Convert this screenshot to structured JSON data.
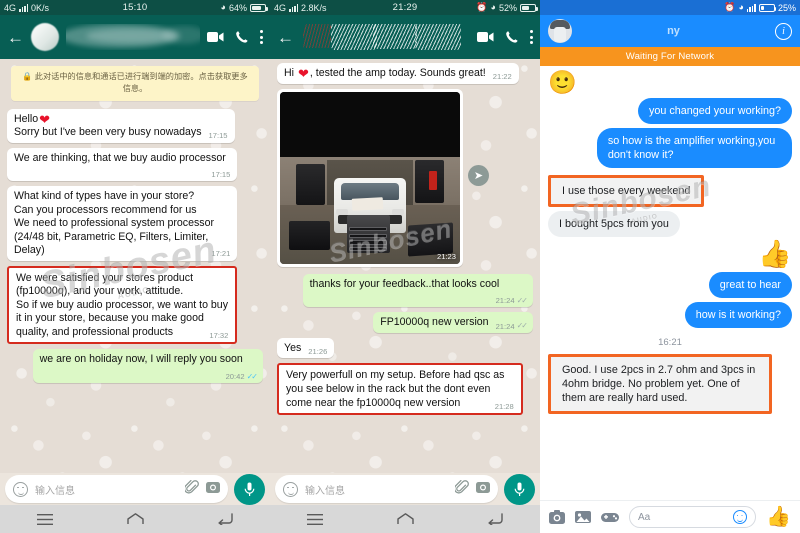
{
  "watermark": {
    "text": "Sinbosen",
    "sub": "AUDIO"
  },
  "panel1": {
    "app": "whatsapp",
    "status": {
      "network": "4G",
      "speed": "0K/s",
      "time": "15:10",
      "battery": "64%",
      "wifi_icon": "wifi-icon"
    },
    "header": {
      "back_icon": "back-arrow-icon",
      "avatar": "contact-avatar",
      "name": "",
      "video_icon": "video-call-icon",
      "call_icon": "voice-call-icon",
      "menu_icon": "overflow-menu-icon"
    },
    "notice": "🔒 此对话中的信息和通话已进行端到端的加密。点击获取更多信息。",
    "messages": [
      {
        "dir": "in",
        "text": "Hello❤\nSorry but I've been very busy nowadays",
        "time": "17:15",
        "highlight": false,
        "heart": true
      },
      {
        "dir": "in",
        "text": "We are thinking, that we buy audio processor",
        "time": "17:15",
        "highlight": false
      },
      {
        "dir": "in",
        "text": "What kind of types have in your store?\nCan you processors recommend for us\nWe need to professional system processor (24/48 bit, Parametric EQ, Filters, Limiter, Delay)",
        "time": "17:21",
        "highlight": false
      },
      {
        "dir": "in",
        "text": "We were satisfied your stores product (fp10000q), and your work, attitude.\nSo if we buy audio processor, we want to buy it in your store, because you make good quality, and professional products",
        "time": "17:32",
        "highlight": true
      },
      {
        "dir": "out",
        "text": "we are on holiday now, I will reply you soon",
        "time": "20:42",
        "highlight": false,
        "ticks": "read"
      }
    ],
    "input": {
      "placeholder": "输入信息",
      "emoji_icon": "emoji-icon",
      "attach_icon": "paperclip-icon",
      "camera_icon": "camera-icon",
      "mic_icon": "microphone-icon"
    },
    "nav": {
      "menu_icon": "recents-icon",
      "home_icon": "home-icon",
      "back_icon": "back-icon"
    }
  },
  "panel2": {
    "app": "whatsapp",
    "status": {
      "network": "4G",
      "speed": "2.8K/s",
      "time": "21:29",
      "battery": "52%",
      "alarm_icon": "alarm-icon",
      "wifi_icon": "wifi-icon"
    },
    "header": {
      "back_icon": "back-arrow-icon",
      "name": "",
      "video_icon": "video-call-icon",
      "call_icon": "voice-call-icon",
      "menu_icon": "overflow-menu-icon"
    },
    "messages": [
      {
        "dir": "in",
        "text": "Hi ❤, tested the amp today. Sounds great!",
        "time": "21:22",
        "highlight": false,
        "heart": true
      },
      {
        "dir": "in",
        "type": "photo",
        "time": "21:23",
        "caption": "garage with van, speakers and amplifier rack",
        "forward_icon": "forward-icon"
      },
      {
        "dir": "out",
        "text": "thanks for your feedback..that looks cool",
        "time": "21:24",
        "highlight": false,
        "ticks": "read"
      },
      {
        "dir": "out",
        "text": "FP10000q new version",
        "time": "21:24",
        "highlight": false,
        "ticks": "read"
      },
      {
        "dir": "in",
        "text": "Yes",
        "time": "21:26",
        "highlight": false
      },
      {
        "dir": "in",
        "text": "Very powerfull on my setup. Before had qsc as you see below in the rack but the dont even come near the fp10000q new version",
        "time": "21:28",
        "highlight": true
      }
    ],
    "input": {
      "placeholder": "输入信息",
      "emoji_icon": "emoji-icon",
      "attach_icon": "paperclip-icon",
      "camera_icon": "camera-icon",
      "mic_icon": "microphone-icon"
    },
    "nav": {
      "menu_icon": "recents-icon",
      "home_icon": "home-icon",
      "back_icon": "back-icon"
    }
  },
  "panel3": {
    "app": "messenger",
    "status": {
      "battery": "25%",
      "alarm_icon": "alarm-icon",
      "wifi_icon": "wifi-icon",
      "signal_icon": "signal-icon"
    },
    "header": {
      "avatar": "contact-avatar",
      "name": "ny",
      "info_icon": "info-icon"
    },
    "banner": "Waiting For Network",
    "messages": [
      {
        "dir": "in",
        "type": "emoji",
        "text": "🙂"
      },
      {
        "dir": "out",
        "text": "you changed your working?",
        "highlight": false
      },
      {
        "dir": "out",
        "text": "so how is the amplifier working,you don't know it?",
        "highlight": false
      },
      {
        "dir": "in",
        "text": "I use those every weekend",
        "highlight": true
      },
      {
        "dir": "in",
        "text": "I bought 5pcs from you",
        "highlight": false
      },
      {
        "dir": "out",
        "type": "thumb",
        "text": "👍"
      },
      {
        "dir": "out",
        "text": "great to hear",
        "highlight": false
      },
      {
        "dir": "out",
        "text": "how is it working?",
        "highlight": false
      },
      {
        "type": "timestamp",
        "text": "16:21"
      },
      {
        "dir": "in",
        "text": "Good. I use 2pcs in 2.7 ohm and 3pcs in 4ohm bridge. No problem yet. One of them are really hard used.",
        "highlight": true
      }
    ],
    "input": {
      "placeholder": "Aa",
      "camera_icon": "camera-icon",
      "gallery_icon": "gallery-icon",
      "games_icon": "games-controller-icon",
      "emoji_icon": "emoji-icon",
      "like_icon": "thumbs-up-icon"
    }
  },
  "colors": {
    "wa_header": "#075e54",
    "wa_out_bubble": "#dcf8c6",
    "fb_blue": "#1a8cff",
    "fb_banner": "#f7941e",
    "highlight_red": "#d52b1e",
    "highlight_orange": "#f26522"
  }
}
